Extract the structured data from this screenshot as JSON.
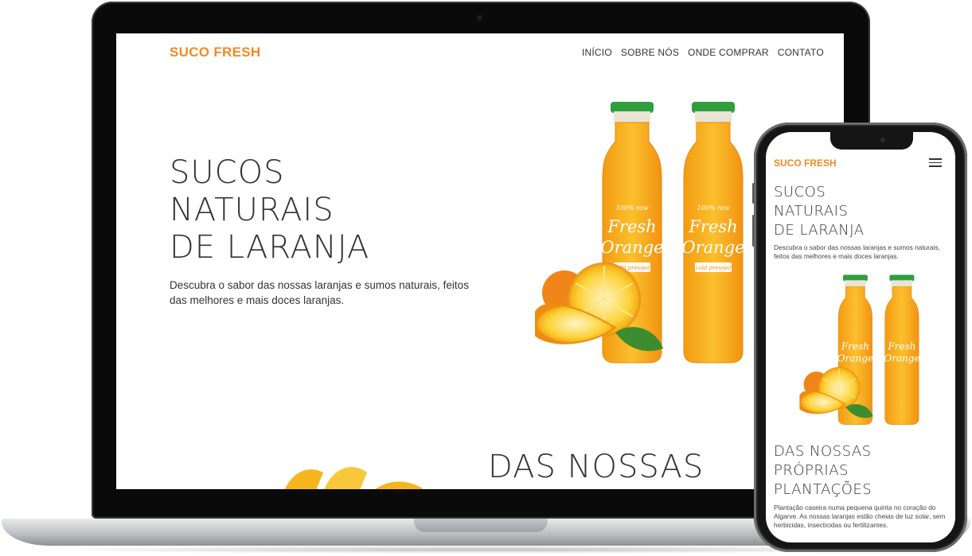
{
  "desktop": {
    "brand": "SUCO FRESH",
    "nav": [
      "INÍCIO",
      "SOBRE NÓS",
      "ONDE COMPRAR",
      "CONTATO"
    ],
    "hero": {
      "title_lines": [
        "SUCOS",
        "NATURAIS",
        "DE LARANJA"
      ],
      "description": "Descubra o sabor das nossas laranjas e sumos naturais, feitos das melhores e mais doces laranjas."
    },
    "section": {
      "title": "DAS NOSSAS"
    },
    "product": {
      "bottle_text_top": "100% raw",
      "bottle_line1": "Fresh",
      "bottle_line2": "Orange",
      "bottle_badge": "cold pressed"
    }
  },
  "mobile": {
    "brand": "SUCO FRESH",
    "menu_icon": "hamburger-icon",
    "hero": {
      "title_lines": [
        "SUCOS",
        "NATURAIS",
        "DE LARANJA"
      ],
      "description": "Descubra o sabor das nossas laranjas e sumos naturais, feitos das melhores e mais doces laranjas."
    },
    "section": {
      "title_lines": [
        "DAS NOSSAS",
        "PRÓPRIAS",
        "PLANTAÇÕES"
      ],
      "description": "Plantação caseira numa pequena quinta no coração do Algarve. As nossas laranjas estão cheias de luz solar, sem herbicidas, insecticidas ou fertilizantes."
    },
    "product": {
      "bottle_line1": "Fresh",
      "bottle_line2": "Orange"
    }
  },
  "colors": {
    "brand_orange": "#f08a24",
    "text_dark": "#333333",
    "juice": "#f7a81b",
    "cap_green": "#2f9e3f"
  }
}
